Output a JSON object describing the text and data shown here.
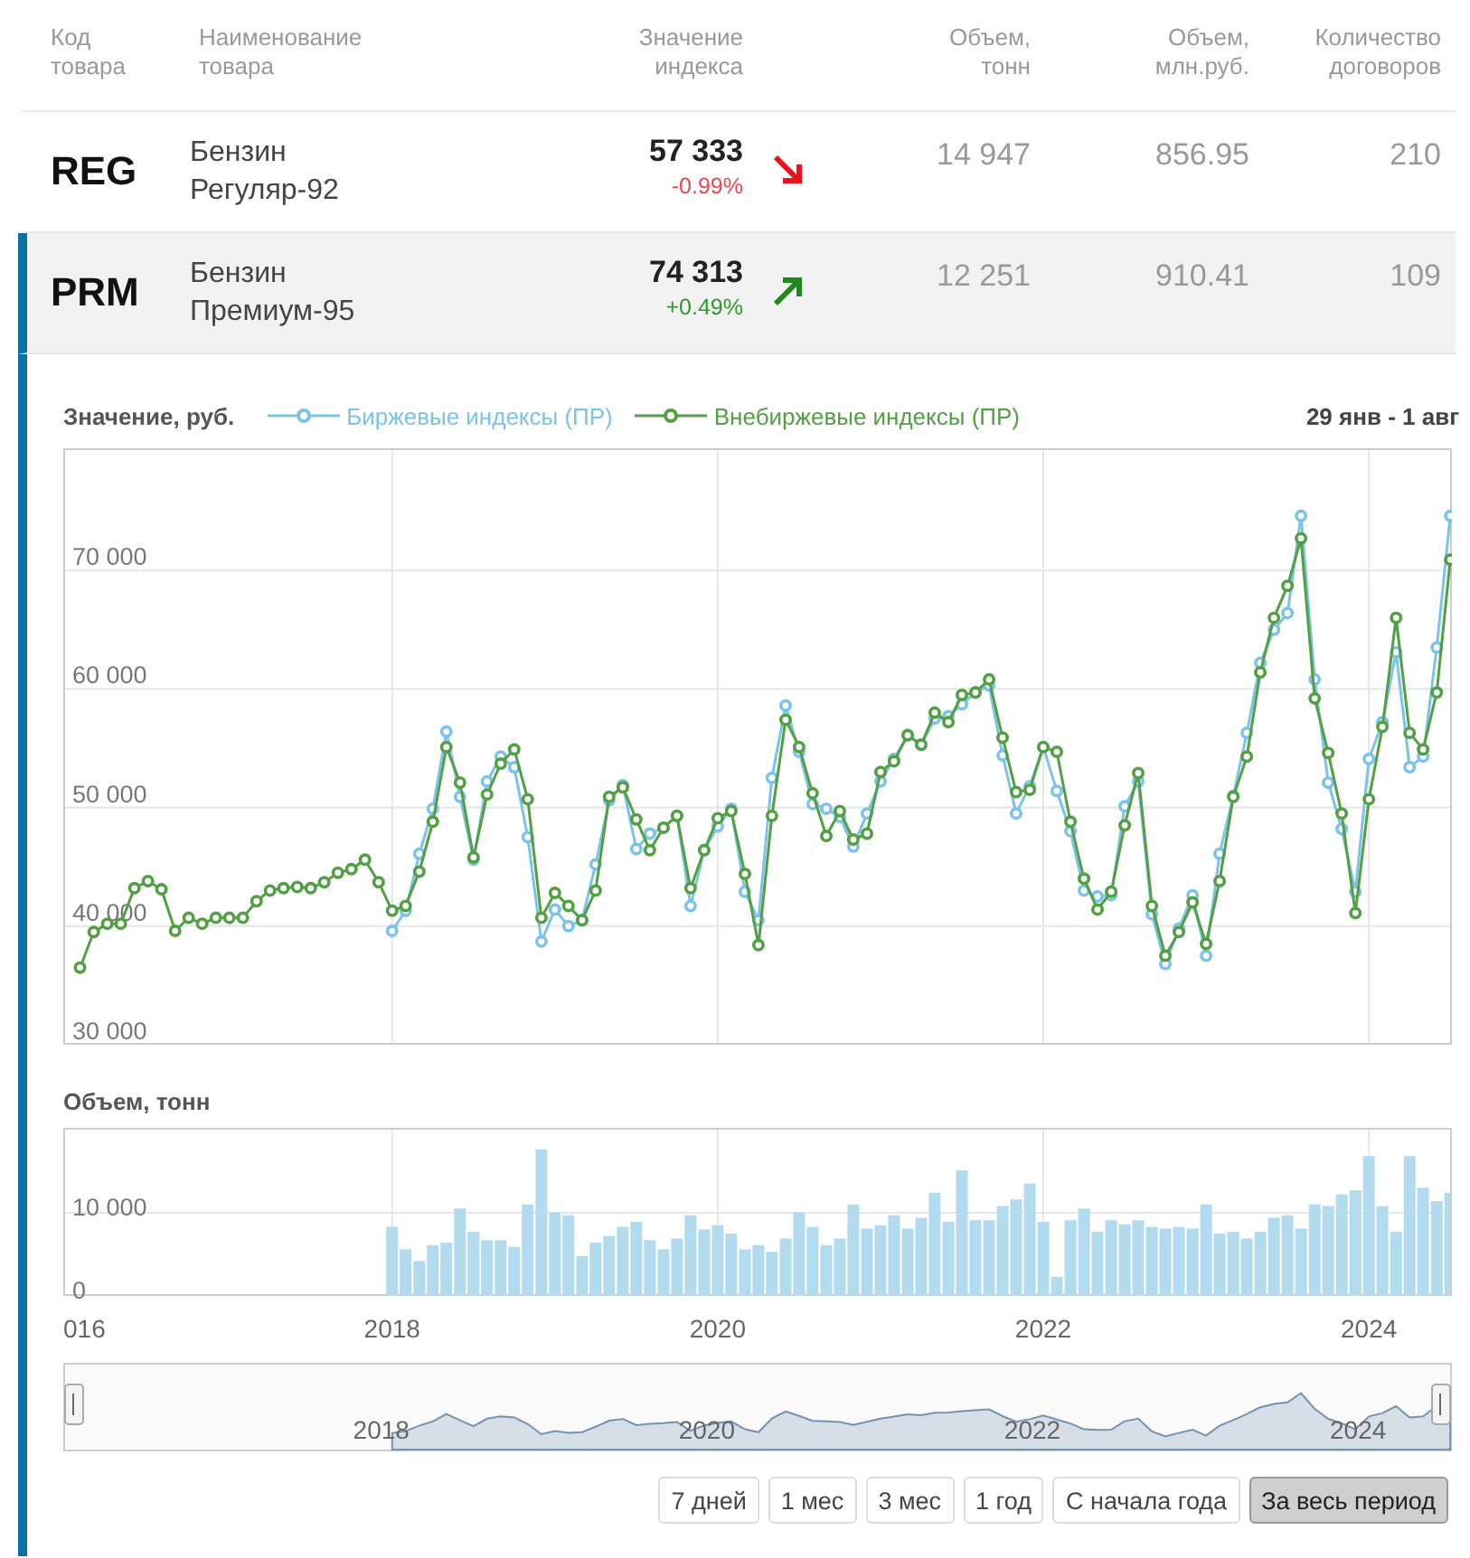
{
  "table": {
    "columns": [
      {
        "label": "Код товара"
      },
      {
        "label": "Наименование товара"
      },
      {
        "label": "Значение индекса"
      },
      {
        "label": "Объем, тонн"
      },
      {
        "label": "Объем, млн.руб."
      },
      {
        "label": "Количество договоров"
      }
    ],
    "rows": [
      {
        "code": "REG",
        "name": "Бензин Регуляр-92",
        "value": "57 333",
        "change": "-0.99%",
        "kind": "down",
        "volume": "14 947",
        "amount": "856.95",
        "contracts": "210",
        "selected": false
      },
      {
        "code": "PRM",
        "name": "Бензин Премиум-95",
        "value": "74 313",
        "change": "+0.49%",
        "kind": "up",
        "volume": "12 251",
        "amount": "910.41",
        "contracts": "109",
        "selected": true
      }
    ]
  },
  "price_chart": {
    "date_range": "29 янв - 1 авг",
    "chart_data": {
      "type": "line",
      "ylabel": "Значение, руб.",
      "grid": true,
      "x": [
        2016.083,
        2016.167,
        2016.25,
        2016.333,
        2016.417,
        2016.5,
        2016.583,
        2016.667,
        2016.75,
        2016.833,
        2016.917,
        2017,
        2017.083,
        2017.167,
        2017.25,
        2017.333,
        2017.417,
        2017.5,
        2017.583,
        2017.667,
        2017.75,
        2017.833,
        2017.917,
        2018,
        2018.083,
        2018.167,
        2018.25,
        2018.333,
        2018.417,
        2018.5,
        2018.583,
        2018.667,
        2018.75,
        2018.833,
        2018.917,
        2019,
        2019.083,
        2019.167,
        2019.25,
        2019.333,
        2019.417,
        2019.5,
        2019.583,
        2019.667,
        2019.75,
        2019.833,
        2019.917,
        2020,
        2020.083,
        2020.167,
        2020.25,
        2020.333,
        2020.417,
        2020.5,
        2020.583,
        2020.667,
        2020.75,
        2020.833,
        2020.917,
        2021,
        2021.083,
        2021.167,
        2021.25,
        2021.333,
        2021.417,
        2021.5,
        2021.583,
        2021.667,
        2021.75,
        2021.833,
        2021.917,
        2022,
        2022.083,
        2022.167,
        2022.25,
        2022.333,
        2022.417,
        2022.5,
        2022.583,
        2022.667,
        2022.75,
        2022.833,
        2022.917,
        2023,
        2023.083,
        2023.167,
        2023.25,
        2023.333,
        2023.417,
        2023.5,
        2023.583,
        2023.667,
        2023.75,
        2023.833,
        2023.917,
        2024,
        2024.083,
        2024.167,
        2024.25,
        2024.333,
        2024.417,
        2024.5
      ],
      "series": [
        {
          "name": "Биржевые индексы (ПР)",
          "color": "#7cc3ea",
          "marker": "circle",
          "values": [
            null,
            null,
            null,
            null,
            null,
            null,
            null,
            null,
            null,
            null,
            null,
            null,
            null,
            null,
            null,
            null,
            null,
            null,
            null,
            null,
            null,
            null,
            null,
            39600,
            41300,
            46100,
            49900,
            56400,
            50900,
            45600,
            52200,
            54300,
            53400,
            47500,
            38700,
            41400,
            40000,
            40500,
            45200,
            50600,
            51900,
            46500,
            47800,
            48300,
            49300,
            41700,
            46400,
            48400,
            49900,
            42900,
            40500,
            52500,
            58600,
            54700,
            50300,
            49900,
            49200,
            46700,
            49500,
            52200,
            54100,
            56100,
            55300,
            57500,
            57700,
            58700,
            59700,
            60300,
            54400,
            49500,
            51800,
            55100,
            51400,
            48000,
            43000,
            42500,
            42600,
            50100,
            52200,
            41000,
            36800,
            39800,
            42600,
            37500,
            46100,
            51000,
            56300,
            62200,
            65000,
            66400,
            74600,
            60800,
            52100,
            48200,
            42900,
            54100,
            57200,
            63100,
            53400,
            54300,
            63500,
            74600
          ]
        },
        {
          "name": "Внебиржевые индексы (ПР)",
          "color": "#52a043",
          "marker": "circle",
          "values": [
            36500,
            39500,
            40200,
            40200,
            43200,
            43800,
            43100,
            39600,
            40700,
            40200,
            40700,
            40700,
            40700,
            42100,
            43000,
            43200,
            43300,
            43200,
            43700,
            44500,
            44800,
            45600,
            43700,
            41300,
            41700,
            44600,
            48800,
            55100,
            52100,
            45800,
            51100,
            53700,
            54900,
            50700,
            40700,
            42800,
            41700,
            40500,
            43000,
            50900,
            51700,
            49000,
            46400,
            48300,
            49300,
            43200,
            46400,
            49100,
            49700,
            44400,
            38400,
            49300,
            57400,
            55100,
            51200,
            47600,
            49700,
            47300,
            47800,
            53000,
            53900,
            56100,
            55300,
            58000,
            57200,
            59500,
            59700,
            60800,
            55900,
            51300,
            51500,
            55100,
            54700,
            48800,
            44000,
            41400,
            42900,
            48500,
            52900,
            41700,
            37500,
            39500,
            42000,
            38500,
            43800,
            50900,
            54300,
            61400,
            66000,
            68700,
            72700,
            59200,
            54600,
            49500,
            41100,
            50700,
            56800,
            66000,
            56300,
            54900,
            59700,
            70900
          ]
        }
      ],
      "xlim": [
        2015.98,
        2024.51
      ],
      "ylim": [
        30000,
        80300
      ],
      "yticks": [
        {
          "value": 30000,
          "label": "30 000"
        },
        {
          "value": 40000,
          "label": "40 000"
        },
        {
          "value": 50000,
          "label": "50 000"
        },
        {
          "value": 60000,
          "label": "60 000"
        },
        {
          "value": 70000,
          "label": "70 000"
        }
      ]
    }
  },
  "volume_chart": {
    "first_tick_label": "016",
    "chart_data": {
      "type": "bar",
      "ylabel": "Объем, тонн",
      "grid": true,
      "x": [
        2018,
        2018.083,
        2018.167,
        2018.25,
        2018.333,
        2018.417,
        2018.5,
        2018.583,
        2018.667,
        2018.75,
        2018.833,
        2018.917,
        2019,
        2019.083,
        2019.167,
        2019.25,
        2019.333,
        2019.417,
        2019.5,
        2019.583,
        2019.667,
        2019.75,
        2019.833,
        2019.917,
        2020,
        2020.083,
        2020.167,
        2020.25,
        2020.333,
        2020.417,
        2020.5,
        2020.583,
        2020.667,
        2020.75,
        2020.833,
        2020.917,
        2021,
        2021.083,
        2021.167,
        2021.25,
        2021.333,
        2021.417,
        2021.5,
        2021.583,
        2021.667,
        2021.75,
        2021.833,
        2021.917,
        2022,
        2022.083,
        2022.167,
        2022.25,
        2022.333,
        2022.417,
        2022.5,
        2022.583,
        2022.667,
        2022.75,
        2022.833,
        2022.917,
        2023,
        2023.083,
        2023.167,
        2023.25,
        2023.333,
        2023.417,
        2023.5,
        2023.583,
        2023.667,
        2023.75,
        2023.833,
        2023.917,
        2024,
        2024.083,
        2024.167,
        2024.25,
        2024.333,
        2024.417,
        2024.5
      ],
      "series": [
        {
          "color": "#b3dbef",
          "values": [
            8300,
            5600,
            4200,
            6100,
            6400,
            10500,
            7700,
            6700,
            6700,
            5900,
            11000,
            17600,
            10000,
            9700,
            4800,
            6400,
            7200,
            8300,
            8900,
            6700,
            5600,
            6900,
            9700,
            8000,
            8500,
            7500,
            5600,
            6100,
            5300,
            6900,
            10000,
            8300,
            6100,
            6900,
            11000,
            8100,
            8500,
            9700,
            8100,
            9400,
            12400,
            8900,
            15100,
            9100,
            9100,
            10800,
            11600,
            13500,
            8900,
            2300,
            9100,
            10500,
            7700,
            9100,
            8600,
            9100,
            8300,
            8100,
            8300,
            8100,
            11000,
            7500,
            7700,
            6900,
            7700,
            9400,
            9700,
            8100,
            11000,
            10800,
            12200,
            12700,
            16800,
            10800,
            7700,
            16800,
            13000,
            11400,
            12400
          ]
        }
      ],
      "xlim": [
        2015.98,
        2024.51
      ],
      "ylim": [
        0,
        20200
      ],
      "xticks": [
        2018,
        2020,
        2022,
        2024
      ],
      "yticks": [
        {
          "value": 0,
          "label": "0"
        },
        {
          "value": 10000,
          "label": "10 000"
        }
      ]
    }
  },
  "navigator": {
    "labels": [
      "2018",
      "2020",
      "2022",
      "2024"
    ]
  },
  "range_buttons": [
    {
      "label": "7 дней",
      "selected": false
    },
    {
      "label": "1 мес",
      "selected": false
    },
    {
      "label": "3 мес",
      "selected": false
    },
    {
      "label": "1 год",
      "selected": false
    },
    {
      "label": "С начала года",
      "selected": false
    },
    {
      "label": "За весь период",
      "selected": true
    }
  ]
}
